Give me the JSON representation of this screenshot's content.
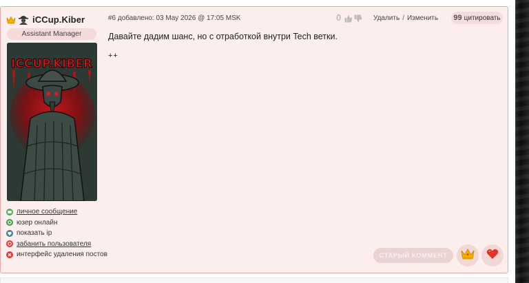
{
  "user": {
    "name": "iCCup.Kiber",
    "role": "Assistant Manager",
    "avatar_text": "ICCUP.KIBER",
    "links": [
      {
        "label": "личное сообщение",
        "color": "#4caf50",
        "icon": "message-icon",
        "underline": true
      },
      {
        "label": "юзер онлайн",
        "color": "#43a047",
        "icon": "online-icon",
        "underline": false
      },
      {
        "label": "показать ip",
        "color": "#3f7f86",
        "icon": "ip-icon",
        "underline": false
      },
      {
        "label": "забанить пользователя",
        "color": "#e53935",
        "icon": "ban-icon",
        "underline": true
      },
      {
        "label": "интерфейс удаления постов",
        "color": "#e53935",
        "icon": "delete-icon",
        "underline": false
      }
    ]
  },
  "post": {
    "meta": "#6 добавлено: 03 May 2026 @ 17:05 MSK",
    "rating": "0",
    "delete_label": "Удалить",
    "separator": "/",
    "edit_label": "Изменить",
    "quote_label": "цитировать",
    "quote_glyph": "99",
    "text": "Давайте дадим шанс, но с отработкой внутри Tech ветки.",
    "extra": "++",
    "old_comment_label": "СТАРЫЙ КОММЕНТ"
  },
  "colors": {
    "post_bg": "#fdeeee",
    "post_border": "#e3a8a8",
    "accent": "#e53935"
  }
}
